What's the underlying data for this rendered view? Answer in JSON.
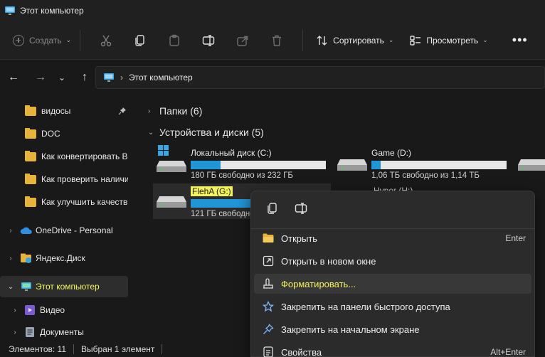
{
  "window": {
    "title": "Этот компьютер"
  },
  "toolbar": {
    "new_label": "Создать",
    "sort_label": "Сортировать",
    "view_label": "Просмотреть",
    "more_label": "•••"
  },
  "address": {
    "path": "Этот компьютер"
  },
  "sidebar": {
    "items": [
      {
        "label": "видосы",
        "icon": "folder-icon"
      },
      {
        "label": "DOC",
        "icon": "folder-icon"
      },
      {
        "label": "Как конвертировать BI",
        "icon": "folder-icon"
      },
      {
        "label": "Как проверить наличи",
        "icon": "folder-icon"
      },
      {
        "label": "Как улучшить качеств",
        "icon": "folder-icon"
      },
      {
        "label": "OneDrive - Personal",
        "icon": "onedrive-icon"
      },
      {
        "label": "Яндекс.Диск",
        "icon": "yandex-disk-icon"
      },
      {
        "label": "Этот компьютер",
        "icon": "this-pc-icon"
      },
      {
        "label": "Видео",
        "icon": "video-folder-icon"
      },
      {
        "label": "Документы",
        "icon": "documents-folder-icon"
      }
    ]
  },
  "content": {
    "folders_header": "Папки (6)",
    "devices_header": "Устройства и диски (5)",
    "drives": [
      {
        "name": "Локальный диск (C:)",
        "free": "180 ГБ свободно из 232 ГБ",
        "used_fraction": 0.22
      },
      {
        "name": "Game (D:)",
        "free": "1,06 ТБ свободно из 1,14 ТБ",
        "used_fraction": 0.07
      },
      {
        "name": "FlehA (G:)",
        "free": "121 ГБ свободно из",
        "used_fraction": 0.95
      },
      {
        "name": "Hyper (H:)"
      }
    ]
  },
  "context_menu": {
    "items": [
      {
        "label": "Открыть",
        "hotkey": "Enter",
        "icon": "folder-open-icon"
      },
      {
        "label": "Открыть в новом окне",
        "hotkey": "",
        "icon": "new-window-icon"
      },
      {
        "label": "Форматировать...",
        "hotkey": "",
        "icon": "format-icon"
      },
      {
        "label": "Закрепить на панели быстрого доступа",
        "hotkey": "",
        "icon": "star-icon"
      },
      {
        "label": "Закрепить на начальном экране",
        "hotkey": "",
        "icon": "pin-icon"
      },
      {
        "label": "Свойства",
        "hotkey": "Alt+Enter",
        "icon": "properties-icon"
      }
    ]
  },
  "status": {
    "items_count": "Элементов: 11",
    "selected": "Выбран 1 элемент"
  },
  "colors": {
    "accent": "#2196d7",
    "highlight": "#f2f25a",
    "background": "#191919"
  }
}
